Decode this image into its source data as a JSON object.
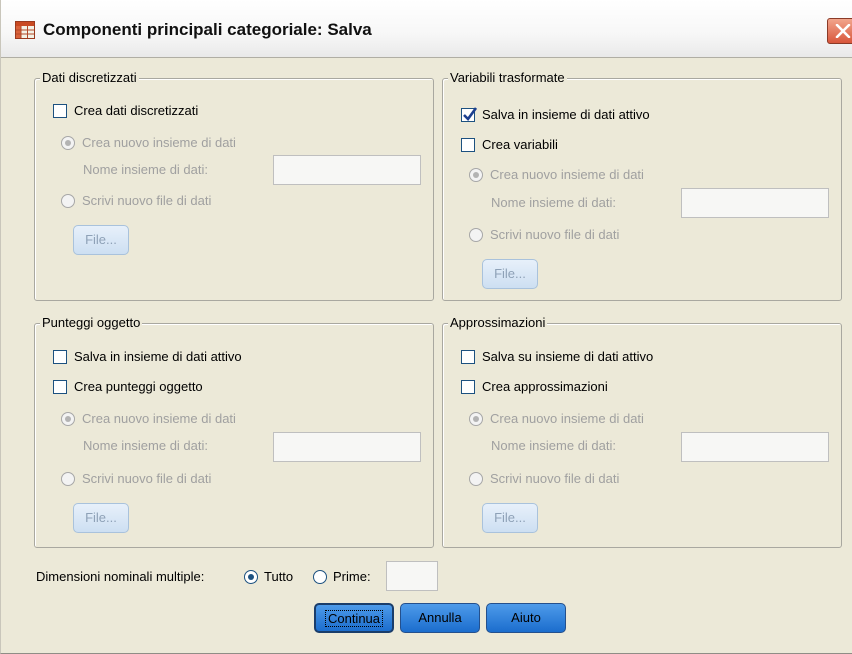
{
  "window": {
    "title": "Componenti principali categoriale: Salva"
  },
  "discretized": {
    "group_label": "Dati discretizzati",
    "create_checkbox": {
      "label": "Crea dati discretizzati",
      "checked": false
    },
    "new_dataset_radio": {
      "label": "Crea nuovo insieme di dati",
      "selected": true,
      "enabled": false
    },
    "dataset_name_label": "Nome insieme di dati:",
    "dataset_name_value": "",
    "write_file_radio": {
      "label": "Scrivi nuovo file di dati",
      "selected": false,
      "enabled": false
    },
    "file_button": "File..."
  },
  "transformed": {
    "group_label": "Variabili trasformate",
    "save_active_checkbox": {
      "label": "Salva in insieme di dati attivo",
      "checked": true
    },
    "create_vars_checkbox": {
      "label": "Crea variabili",
      "checked": false
    },
    "new_dataset_radio": {
      "label": "Crea nuovo insieme di dati",
      "selected": true,
      "enabled": false
    },
    "dataset_name_label": "Nome insieme di dati:",
    "dataset_name_value": "",
    "write_file_radio": {
      "label": "Scrivi nuovo file di dati",
      "selected": false,
      "enabled": false
    },
    "file_button": "File..."
  },
  "object_scores": {
    "group_label": "Punteggi oggetto",
    "save_active_checkbox": {
      "label": "Salva in insieme di dati attivo",
      "checked": false
    },
    "create_scores_checkbox": {
      "label": "Crea punteggi oggetto",
      "checked": false
    },
    "new_dataset_radio": {
      "label": "Crea nuovo insieme di dati",
      "selected": true,
      "enabled": false
    },
    "dataset_name_label": "Nome insieme di dati:",
    "dataset_name_value": "",
    "write_file_radio": {
      "label": "Scrivi nuovo file di dati",
      "selected": false,
      "enabled": false
    },
    "file_button": "File..."
  },
  "approximations": {
    "group_label": "Approssimazioni",
    "save_active_checkbox": {
      "label": "Salva su insieme di dati attivo",
      "checked": false
    },
    "create_approx_checkbox": {
      "label": "Crea approssimazioni",
      "checked": false
    },
    "new_dataset_radio": {
      "label": "Crea nuovo insieme di dati",
      "selected": true,
      "enabled": false
    },
    "dataset_name_label": "Nome insieme di dati:",
    "dataset_name_value": "",
    "write_file_radio": {
      "label": "Scrivi nuovo file di dati",
      "selected": false,
      "enabled": false
    },
    "file_button": "File..."
  },
  "multiple_nominal": {
    "label": "Dimensioni nominali multiple:",
    "all_radio": {
      "label": "Tutto",
      "selected": true
    },
    "first_radio": {
      "label": "Prime:",
      "selected": false
    },
    "first_value": ""
  },
  "buttons": {
    "continue": "Continua",
    "cancel": "Annulla",
    "help": "Aiuto"
  },
  "colors": {
    "dialog_bg": "#ece9d8",
    "button_blue": "#2f80dc",
    "close_red": "#d8563b"
  }
}
